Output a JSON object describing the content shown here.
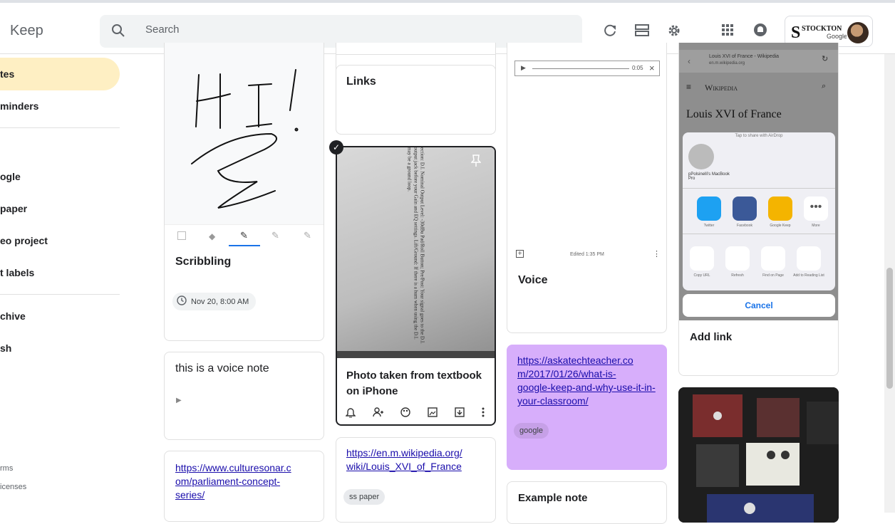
{
  "app": {
    "title": "Keep"
  },
  "search": {
    "placeholder": "Search"
  },
  "account": {
    "logo_text": "STOCKTON",
    "logo_sub": "Google"
  },
  "sidebar": {
    "items": [
      {
        "label": "tes",
        "active": true
      },
      {
        "label": "minders"
      },
      {
        "label": "ogle"
      },
      {
        "label": "paper"
      },
      {
        "label": "eo project"
      },
      {
        "label": "t labels"
      },
      {
        "label": "chive"
      },
      {
        "label": "sh"
      }
    ],
    "footer": {
      "terms": "rms",
      "licenses": "icenses"
    }
  },
  "notes": {
    "scribbling": {
      "drawing_text": "HI!",
      "title": "Scribbling",
      "reminder": "Nov 20, 8:00 AM"
    },
    "voice_note": {
      "title": "this is a voice note"
    },
    "culturesonar": {
      "link": "https://www.culturesonar.com/parliament-concept-series/",
      "link_lines": [
        "https://www.culturesonar.c",
        "om/parliament-concept-",
        "series/"
      ]
    },
    "links": {
      "title": "Links"
    },
    "photo": {
      "title_lines": [
        "Photo taken from textbook",
        "on iPhone"
      ],
      "photo_text": "D.I. Section: D.I. Nominal Output Level: -30dBu Pad/Roll Button; Pre/Post: Your signal goes to the D.I. XLR output jack before your Gain and EQ settings. Lift/Ground: If there is a hum when using the D.I. there may be a ground loop."
    },
    "wikipedia": {
      "link_lines": [
        "https://en.m.wikipedia.org/",
        "wiki/Louis_XVI_of_France"
      ],
      "label": "ss paper"
    },
    "voice": {
      "audio_time": "0:05",
      "edited": "Edited 1:35 PM",
      "title": "Voice"
    },
    "askatech": {
      "link_lines": [
        "https://askatechteacher.co",
        "m/2017/01/26/what-is-",
        "google-keep-and-why-use-it-in-",
        "your-classroom/"
      ],
      "label": "google"
    },
    "example": {
      "title": "Example note"
    },
    "addlink": {
      "title": "Add link",
      "screenshot": {
        "tab_title": "Louis XVI of France - Wikipedia",
        "tab_url": "en.m.wikipedia.org",
        "wiki_brand": "Wikipedia",
        "page_title": "Louis XVI of France",
        "airdrop_hint": "Tap to share with AirDrop",
        "airdrop_device": "pPolsinelli's MacBook Pro",
        "share_apps": [
          "Twitter",
          "Facebook",
          "Google Keep",
          "More"
        ],
        "actions": [
          "Copy URL",
          "Refresh",
          "Find on Page",
          "Add to Reading List"
        ],
        "cancel": "Cancel"
      }
    }
  }
}
